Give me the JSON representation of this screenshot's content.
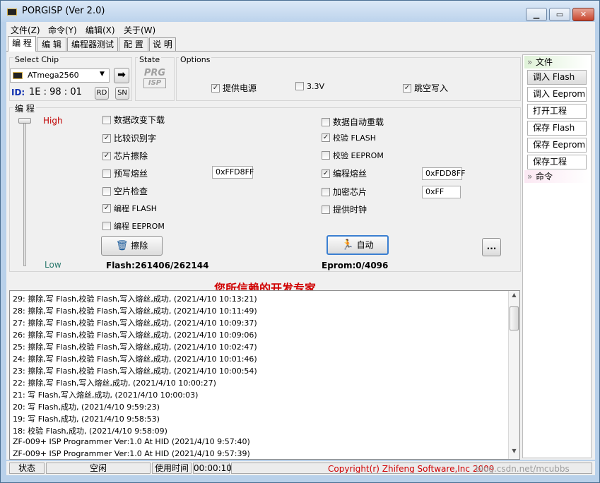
{
  "window": {
    "title": "PORGISP (Ver 2.0)",
    "min": "▁",
    "max": "▭",
    "close": "✕"
  },
  "menu": [
    "文件(Z)",
    "命令(Y)",
    "编辑(X)",
    "关于(W)"
  ],
  "tabs": [
    "编 程",
    "编 辑",
    "编程器测试",
    "配 置",
    "说 明"
  ],
  "chip": {
    "section_label": "Select Chip",
    "name": "ATmega2560",
    "id_label": "ID:",
    "id_value": "1E : 98 : 01",
    "rd": "RD",
    "sn": "SN"
  },
  "state": {
    "label": "State",
    "logo_top": "PRG",
    "logo_bottom": "ISP"
  },
  "options": {
    "label": "Options",
    "items": [
      {
        "label": "提供电源",
        "checked": true
      },
      {
        "label": "3.3V",
        "checked": false
      },
      {
        "label": "跳空写入",
        "checked": true
      }
    ]
  },
  "program": {
    "label": "编 程",
    "high": "High",
    "low": "Low",
    "left": [
      {
        "label": "数据改变下载",
        "checked": false
      },
      {
        "label": "比较识别字",
        "checked": true
      },
      {
        "label": "芯片擦除",
        "checked": true
      },
      {
        "label": "预写熔丝",
        "checked": false
      },
      {
        "label": "空片检查",
        "checked": false
      },
      {
        "label": "编程 FLASH",
        "checked": true
      },
      {
        "label": "编程 EEPROM",
        "checked": false
      }
    ],
    "right": [
      {
        "label": "数据自动重载",
        "checked": false
      },
      {
        "label": "校验 FLASH",
        "checked": true
      },
      {
        "label": "校验 EEPROM",
        "checked": false
      },
      {
        "label": "编程熔丝",
        "checked": true
      },
      {
        "label": "加密芯片",
        "checked": false
      },
      {
        "label": "提供时钟",
        "checked": false
      }
    ],
    "prefuse_value": "0xFFD8FF",
    "fuse_value": "0xFDD8FF",
    "lock_value": "0xFF",
    "erase_btn": "擦除",
    "auto_btn": "自动",
    "more_btn": "...",
    "flash_info": "Flash:261406/262144",
    "eprom_info": "Eprom:0/4096"
  },
  "slogan": "您所信赖的开发专家",
  "log": [
    "29: 擦除,写 Flash,校验 Flash,写入熔丝,成功, (2021/4/10 10:13:21)",
    "28: 擦除,写 Flash,校验 Flash,写入熔丝,成功, (2021/4/10 10:11:49)",
    "27: 擦除,写 Flash,校验 Flash,写入熔丝,成功, (2021/4/10 10:09:37)",
    "26: 擦除,写 Flash,校验 Flash,写入熔丝,成功, (2021/4/10 10:09:06)",
    "25: 擦除,写 Flash,校验 Flash,写入熔丝,成功, (2021/4/10 10:02:47)",
    "24: 擦除,写 Flash,校验 Flash,写入熔丝,成功, (2021/4/10 10:01:46)",
    "23: 擦除,写 Flash,校验 Flash,写入熔丝,成功, (2021/4/10 10:00:54)",
    "22: 擦除,写 Flash,写入熔丝,成功, (2021/4/10 10:00:27)",
    "21: 写 Flash,写入熔丝,成功, (2021/4/10 10:00:03)",
    "20: 写 Flash,成功, (2021/4/10 9:59:23)",
    "19: 写 Flash,成功, (2021/4/10 9:58:53)",
    "18: 校验 Flash,成功, (2021/4/10 9:58:09)",
    "ZF-009+ ISP Programmer Ver:1.0 At HID (2021/4/10 9:57:40)",
    "ZF-009+ ISP Programmer Ver:1.0 At HID (2021/4/10 9:57:39)"
  ],
  "status": {
    "state_label": "状态",
    "state_value": "空闲",
    "time_label": "使用时间",
    "time_value": "00:00:10",
    "copyright": "Copyright(r) Zhifeng Software,Inc 2009",
    "watermark": "blog.csdn.net/mcubbs"
  },
  "sidebar": {
    "file_header": "文件",
    "file_items": [
      "调入 Flash",
      "调入 Eeprom",
      "打开工程",
      "保存 Flash",
      "保存 Eeprom",
      "保存工程"
    ],
    "cmd_header": "命令"
  },
  "colors": {
    "high": "#c00000",
    "low": "#2c7a6e",
    "slogan": "#d00000",
    "id_label": "#1030b0",
    "copyright": "#d00000"
  }
}
